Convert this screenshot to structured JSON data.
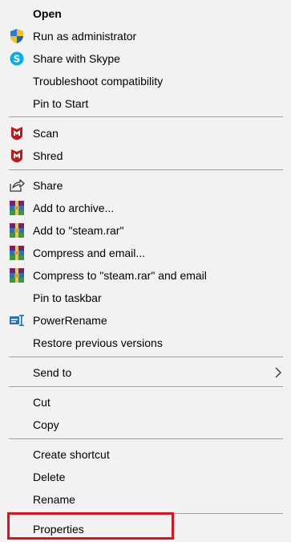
{
  "menu": {
    "open": "Open",
    "run_as_admin": "Run as administrator",
    "share_skype": "Share with Skype",
    "troubleshoot": "Troubleshoot compatibility",
    "pin_start": "Pin to Start",
    "scan": "Scan",
    "shred": "Shred",
    "share": "Share",
    "add_archive": "Add to archive...",
    "add_steam_rar": "Add to \"steam.rar\"",
    "compress_email": "Compress and email...",
    "compress_steam_email": "Compress to \"steam.rar\" and email",
    "pin_taskbar": "Pin to taskbar",
    "power_rename": "PowerRename",
    "restore_versions": "Restore previous versions",
    "send_to": "Send to",
    "cut": "Cut",
    "copy": "Copy",
    "create_shortcut": "Create shortcut",
    "delete": "Delete",
    "rename": "Rename",
    "properties": "Properties"
  },
  "colors": {
    "menu_background": "#f2f2f2",
    "separator": "#a0a0a0",
    "highlight_box": "#e0101c",
    "mcafee_red": "#c01818",
    "skype_blue": "#00aff0"
  },
  "icons": {
    "run_as_admin": "uac-shield-icon",
    "share_skype": "skype-icon",
    "scan": "mcafee-icon",
    "shred": "mcafee-icon",
    "share": "share-icon",
    "winrar": "winrar-icon",
    "power_rename": "powerrename-icon",
    "send_to": "chevron-right-icon"
  }
}
